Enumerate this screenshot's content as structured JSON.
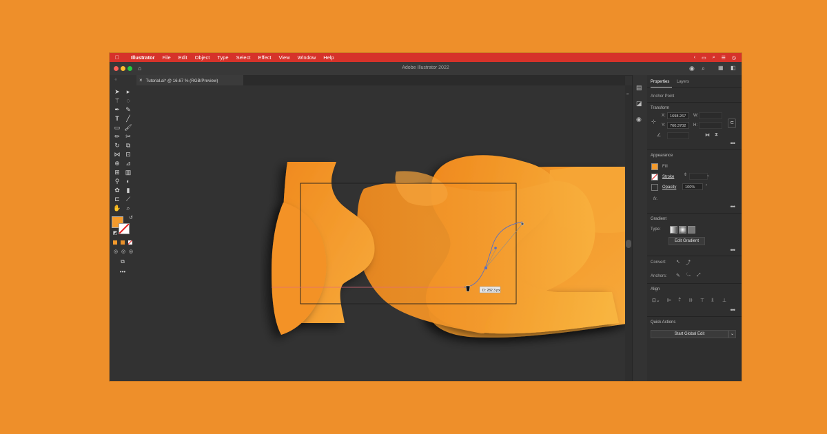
{
  "menubar": {
    "apple": "",
    "items": [
      "Illustrator",
      "File",
      "Edit",
      "Object",
      "Type",
      "Select",
      "Effect",
      "View",
      "Window",
      "Help"
    ]
  },
  "titlebar": {
    "title": "Adobe Illustrator 2022"
  },
  "document": {
    "tab_label": "Tutorial.ai* @ 16.67 % (RGB/Preview)",
    "close": "×"
  },
  "canvas": {
    "measure_label": "D: 282.3 px"
  },
  "panel": {
    "tabs": {
      "properties": "Properties",
      "layers": "Layers"
    },
    "selection_type": "Anchor Point",
    "transform": {
      "heading": "Transform",
      "x_label": "X:",
      "x_value": "1698.267",
      "y_label": "Y:",
      "y_value": "760.3702",
      "w_label": "W:",
      "h_label": "H:"
    },
    "appearance": {
      "heading": "Appearance",
      "fill": "Fill",
      "stroke": "Stroke",
      "opacity": "Opacity",
      "opacity_value": "100%",
      "fx": "fx."
    },
    "gradient": {
      "heading": "Gradient",
      "type_label": "Type:",
      "edit_button": "Edit Gradient"
    },
    "convert_label": "Convert:",
    "anchors_label": "Anchors:",
    "align_heading": "Align",
    "quick_actions": {
      "heading": "Quick Actions",
      "button": "Start Global Edit"
    }
  },
  "colors": {
    "menubar": "#d6322a",
    "background": "#ee8f2a",
    "fill_swatch": "#f39a2c"
  }
}
